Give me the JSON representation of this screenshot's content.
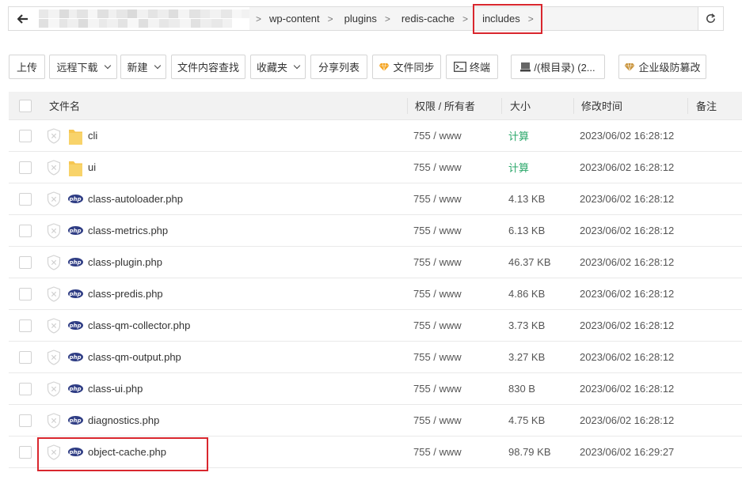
{
  "breadcrumb": {
    "items": [
      "wp-content",
      "plugins",
      "redis-cache",
      "includes"
    ]
  },
  "toolbar": {
    "upload": "上传",
    "remote_download": "远程下载",
    "new": "新建",
    "content_search": "文件内容查找",
    "favorites": "收藏夹",
    "share_list": "分享列表",
    "file_sync": "文件同步",
    "terminal": "终端",
    "disk": "/(根目录) (2...",
    "enterprise_protect": "企业级防篡改"
  },
  "table": {
    "headers": {
      "name": "文件名",
      "permission": "权限 / 所有者",
      "size": "大小",
      "mtime": "修改时间",
      "note": "备注"
    },
    "rows": [
      {
        "name": "cli",
        "type": "folder",
        "perm": "755 / www",
        "size": "计算",
        "mtime": "2023/06/02 16:28:12"
      },
      {
        "name": "ui",
        "type": "folder",
        "perm": "755 / www",
        "size": "计算",
        "mtime": "2023/06/02 16:28:12"
      },
      {
        "name": "class-autoloader.php",
        "type": "php",
        "perm": "755 / www",
        "size": "4.13 KB",
        "mtime": "2023/06/02 16:28:12"
      },
      {
        "name": "class-metrics.php",
        "type": "php",
        "perm": "755 / www",
        "size": "6.13 KB",
        "mtime": "2023/06/02 16:28:12"
      },
      {
        "name": "class-plugin.php",
        "type": "php",
        "perm": "755 / www",
        "size": "46.37 KB",
        "mtime": "2023/06/02 16:28:12"
      },
      {
        "name": "class-predis.php",
        "type": "php",
        "perm": "755 / www",
        "size": "4.86 KB",
        "mtime": "2023/06/02 16:28:12"
      },
      {
        "name": "class-qm-collector.php",
        "type": "php",
        "perm": "755 / www",
        "size": "3.73 KB",
        "mtime": "2023/06/02 16:28:12"
      },
      {
        "name": "class-qm-output.php",
        "type": "php",
        "perm": "755 / www",
        "size": "3.27 KB",
        "mtime": "2023/06/02 16:28:12"
      },
      {
        "name": "class-ui.php",
        "type": "php",
        "perm": "755 / www",
        "size": "830 B",
        "mtime": "2023/06/02 16:28:12"
      },
      {
        "name": "diagnostics.php",
        "type": "php",
        "perm": "755 / www",
        "size": "4.75 KB",
        "mtime": "2023/06/02 16:28:12"
      },
      {
        "name": "object-cache.php",
        "type": "php",
        "perm": "755 / www",
        "size": "98.79 KB",
        "mtime": "2023/06/02 16:29:27"
      }
    ]
  },
  "icons": {
    "php_badge": "php"
  },
  "colors": {
    "highlight_border": "#d9272e",
    "calc_green": "#2aa76a",
    "folder_yellow": "#f6c651",
    "php_badge": "#2f3d84"
  }
}
